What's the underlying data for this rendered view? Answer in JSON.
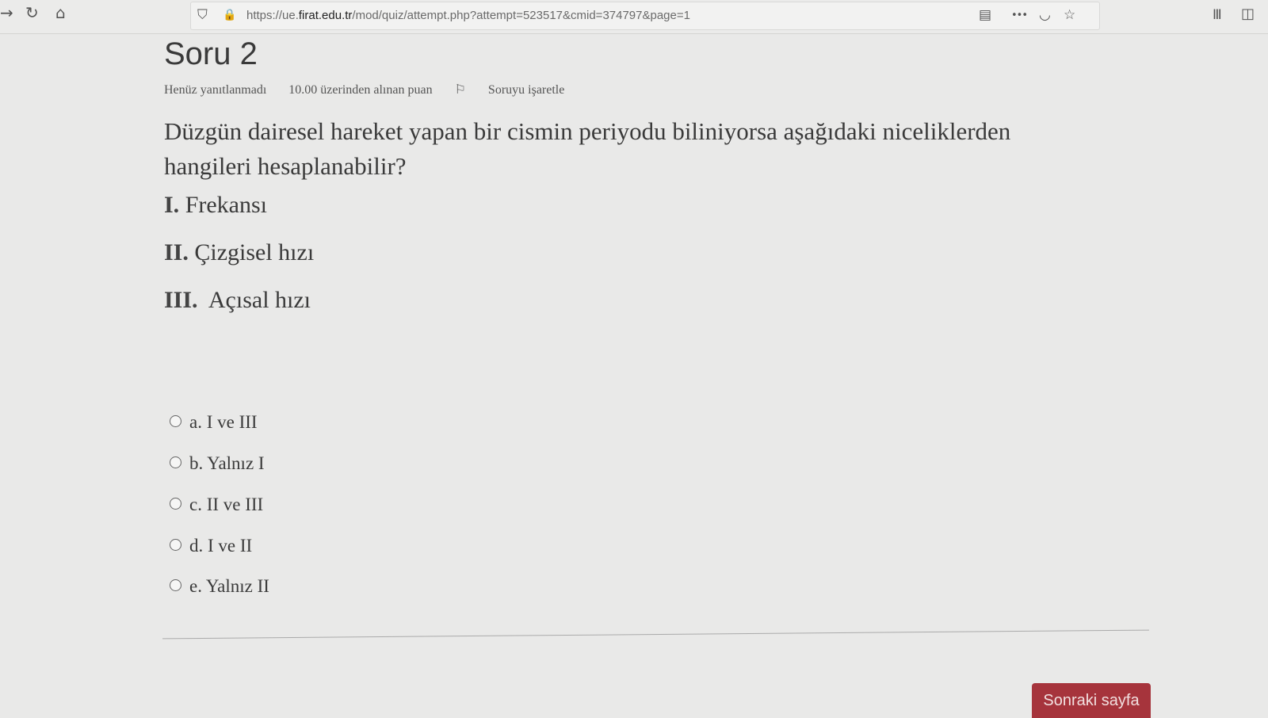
{
  "browser": {
    "url_prefix": "https://ue.",
    "url_host": "firat.edu.tr",
    "url_path": "/mod/quiz/attempt.php?attempt=523517&cmid=374797&page=1",
    "icons": {
      "back": "→",
      "reload": "↻",
      "home": "⌂",
      "shield": "⛉",
      "lock": "🔒",
      "reader": "▤",
      "more": "•••",
      "pocket": "◡",
      "star": "☆",
      "library": "Ⅲ",
      "sidebar": "◫"
    }
  },
  "question": {
    "title": "Soru 2",
    "status": "Henüz yanıtlanmadı",
    "grade": "10.00 üzerinden alınan puan",
    "flag_icon": "⚐",
    "flag_label": "Soruyu işaretle",
    "text": "Düzgün dairesel hareket yapan bir cismin periyodu biliniyorsa aşağıdaki niceliklerden hangileri hesaplanabilir?",
    "items": [
      {
        "num": "I.",
        "label": "Frekansı"
      },
      {
        "num": "II.",
        "label": "Çizgisel hızı"
      },
      {
        "num": "III.",
        "label": "Açısal hızı"
      }
    ],
    "answers": [
      {
        "label": "a. I ve III"
      },
      {
        "label": "b. Yalnız I"
      },
      {
        "label": "c. II ve III"
      },
      {
        "label": "d. I ve II"
      },
      {
        "label": "e. Yalnız II"
      }
    ]
  },
  "navigation": {
    "next_label": "Sonraki sayfa"
  }
}
